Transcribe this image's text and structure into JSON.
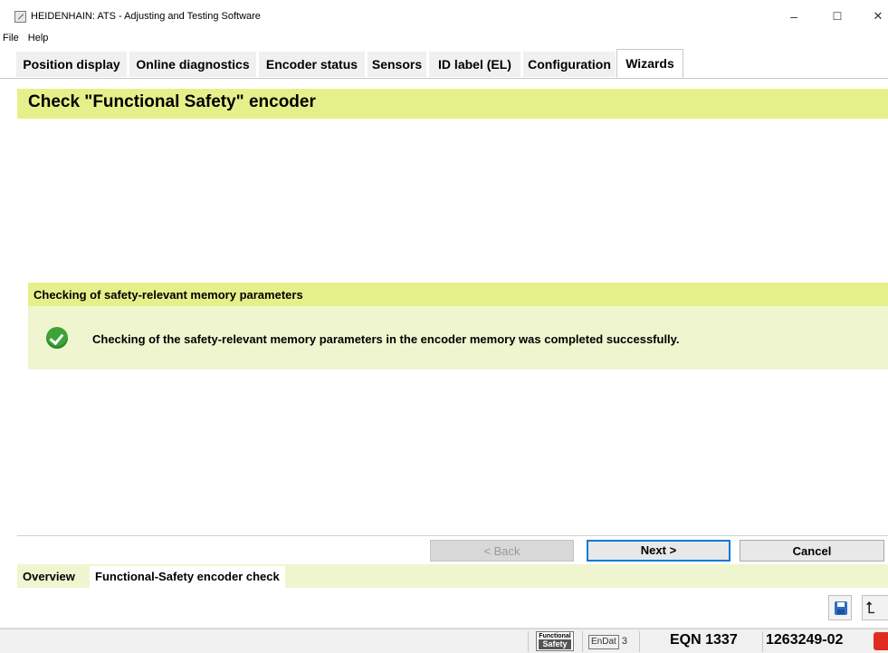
{
  "window": {
    "title": "HEIDENHAIN: ATS - Adjusting and Testing Software",
    "controls": {
      "minimize": "–",
      "maximize": "☐",
      "close": "✕"
    }
  },
  "menu": {
    "items": [
      "File",
      "Help"
    ]
  },
  "tabs": [
    {
      "label": "Position display",
      "active": false
    },
    {
      "label": "Online diagnostics",
      "active": false
    },
    {
      "label": "Encoder status",
      "active": false
    },
    {
      "label": "Sensors",
      "active": false
    },
    {
      "label": "ID label (EL)",
      "active": false
    },
    {
      "label": "Configuration",
      "active": false
    },
    {
      "label": "Wizards",
      "active": true
    }
  ],
  "wizard": {
    "title": "Check \"Functional Safety\" encoder",
    "section_title": "Checking of safety-relevant memory parameters",
    "message": "Checking of the safety-relevant memory parameters in the encoder memory was completed successfully.",
    "status_icon": "check-circle-icon",
    "buttons": {
      "back": "< Back",
      "next": "Next >",
      "cancel": "Cancel"
    }
  },
  "bottom_tabs": [
    {
      "label": "Overview",
      "active": false
    },
    {
      "label": "Functional-Safety encoder check",
      "active": true
    }
  ],
  "toolbar": {
    "save_icon": "save-icon",
    "update_icon": "update-icon"
  },
  "status": {
    "fs_line1": "Functional",
    "fs_line2": "Safety",
    "endat_label": "EnDat",
    "endat_version": "3",
    "model": "EQN 1337",
    "serial": "1263249-02"
  },
  "colors": {
    "header_bg": "#e6f08a",
    "section_body_bg": "#eff6cf",
    "check_green": "#3da338",
    "next_border": "#0a78d7"
  }
}
